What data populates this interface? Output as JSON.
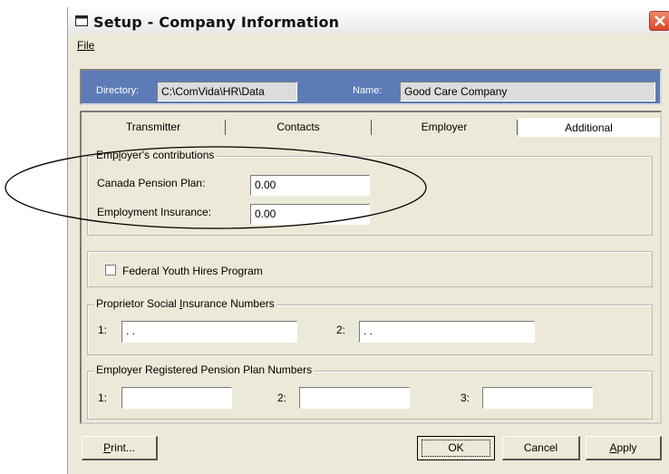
{
  "window": {
    "title": "Setup - Company Information",
    "icon": "window-icon",
    "close_icon": "close-icon"
  },
  "menu": {
    "file": "File"
  },
  "info": {
    "directory_label": "Directory:",
    "directory_value": "C:\\ComVida\\HR\\Data",
    "name_label": "Name:",
    "name_value": "Good Care Company"
  },
  "tabs": [
    {
      "label": "Transmitter"
    },
    {
      "label": "Contacts"
    },
    {
      "label": "Employer"
    },
    {
      "label": "Additional",
      "active": true
    }
  ],
  "contributions": {
    "title": "Employer's contributions",
    "cpp_label": "Canada Pension Plan:",
    "cpp_value": "0.00",
    "ei_label": "Employment Insurance:",
    "ei_value": "0.00"
  },
  "youth": {
    "label": "Federal Youth Hires Program",
    "checked": false
  },
  "sin": {
    "title": "Proprietor Social Insurance Numbers",
    "label1": "1:",
    "value1": " .  .",
    "label2": "2:",
    "value2": " .  ."
  },
  "pension": {
    "title": "Employer Registered Pension Plan Numbers",
    "label1": "1:",
    "label2": "2:",
    "label3": "3:",
    "value1": "",
    "value2": "",
    "value3": ""
  },
  "buttons": {
    "print": "Print...",
    "ok": "OK",
    "cancel": "Cancel",
    "apply": "Apply"
  },
  "colors": {
    "info_bar": "#5c7bb7",
    "dialog_bg": "#ece9d8",
    "close_button": "#d5492a"
  }
}
